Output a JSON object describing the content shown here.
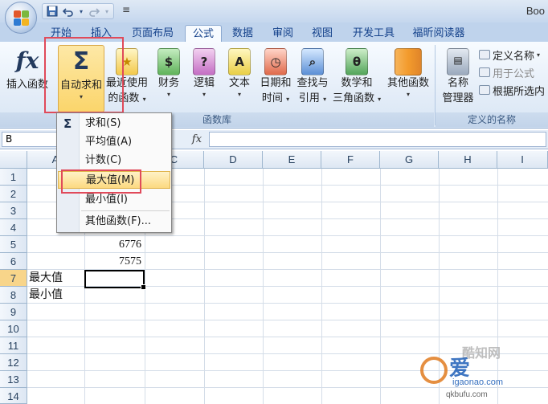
{
  "window": {
    "title": "Boo"
  },
  "quick_access": {
    "save_icon": "save-icon",
    "undo_icon": "undo-icon",
    "redo_icon": "redo-icon",
    "more": "≡"
  },
  "tabs": [
    {
      "label": "开始",
      "active": false
    },
    {
      "label": "插入",
      "active": false
    },
    {
      "label": "页面布局",
      "active": false
    },
    {
      "label": "公式",
      "active": true
    },
    {
      "label": "数据",
      "active": false
    },
    {
      "label": "审阅",
      "active": false
    },
    {
      "label": "视图",
      "active": false
    },
    {
      "label": "开发工具",
      "active": false
    },
    {
      "label": "福昕阅读器",
      "active": false
    }
  ],
  "ribbon": {
    "function_library": {
      "group_label": "函数库",
      "insert_function": "插入函数",
      "insert_function_icon": "fx",
      "autosum_line1": "自动求和",
      "autosum_icon": "Σ",
      "recent_line1": "最近使用",
      "recent_line2": "的函数",
      "financial": "财务",
      "logical": "逻辑",
      "text": "文本",
      "datetime_line1": "日期和",
      "datetime_line2": "时间",
      "lookup_line1": "查找与",
      "lookup_line2": "引用",
      "math_line1": "数学和",
      "math_line2": "三角函数",
      "more": "其他函数",
      "caret": "▾"
    },
    "defined_names": {
      "group_label": "定义的名称",
      "name_manager_line1": "名称",
      "name_manager_line2": "管理器",
      "define_name": "定义名称",
      "use_in_formula": "用于公式",
      "create_from_selection": "根据所选内"
    }
  },
  "formula_bar": {
    "name_box": "B",
    "fx": "fx",
    "value": ""
  },
  "columns": [
    "A",
    "B",
    "C",
    "D",
    "E",
    "F",
    "G",
    "H",
    "I"
  ],
  "rows": [
    "1",
    "2",
    "3",
    "4",
    "5",
    "6",
    "7",
    "8",
    "9",
    "10",
    "11",
    "12",
    "13",
    "14"
  ],
  "cells": {
    "B4": "63",
    "B5": "6776",
    "B6": "7575",
    "A7": "最大值",
    "A8": "最小值"
  },
  "active_cell": "B7",
  "dropdown": {
    "icon": "Σ",
    "items": [
      {
        "label": "求和(S)"
      },
      {
        "label": "平均值(A)"
      },
      {
        "label": "计数(C)"
      },
      {
        "label": "最大值(M)",
        "highlighted": true
      },
      {
        "label": "最小值(I)"
      },
      {
        "label": "其他函数(F)..."
      }
    ]
  },
  "watermark": {
    "top": "酷知网",
    "big": "爱",
    "url": "igaonao.com",
    "url2": "qkbufu.com"
  },
  "colors": {
    "highlight_red": "#e04a5a",
    "menu_hover": "#fcd980",
    "ribbon_text": "#15428b"
  }
}
